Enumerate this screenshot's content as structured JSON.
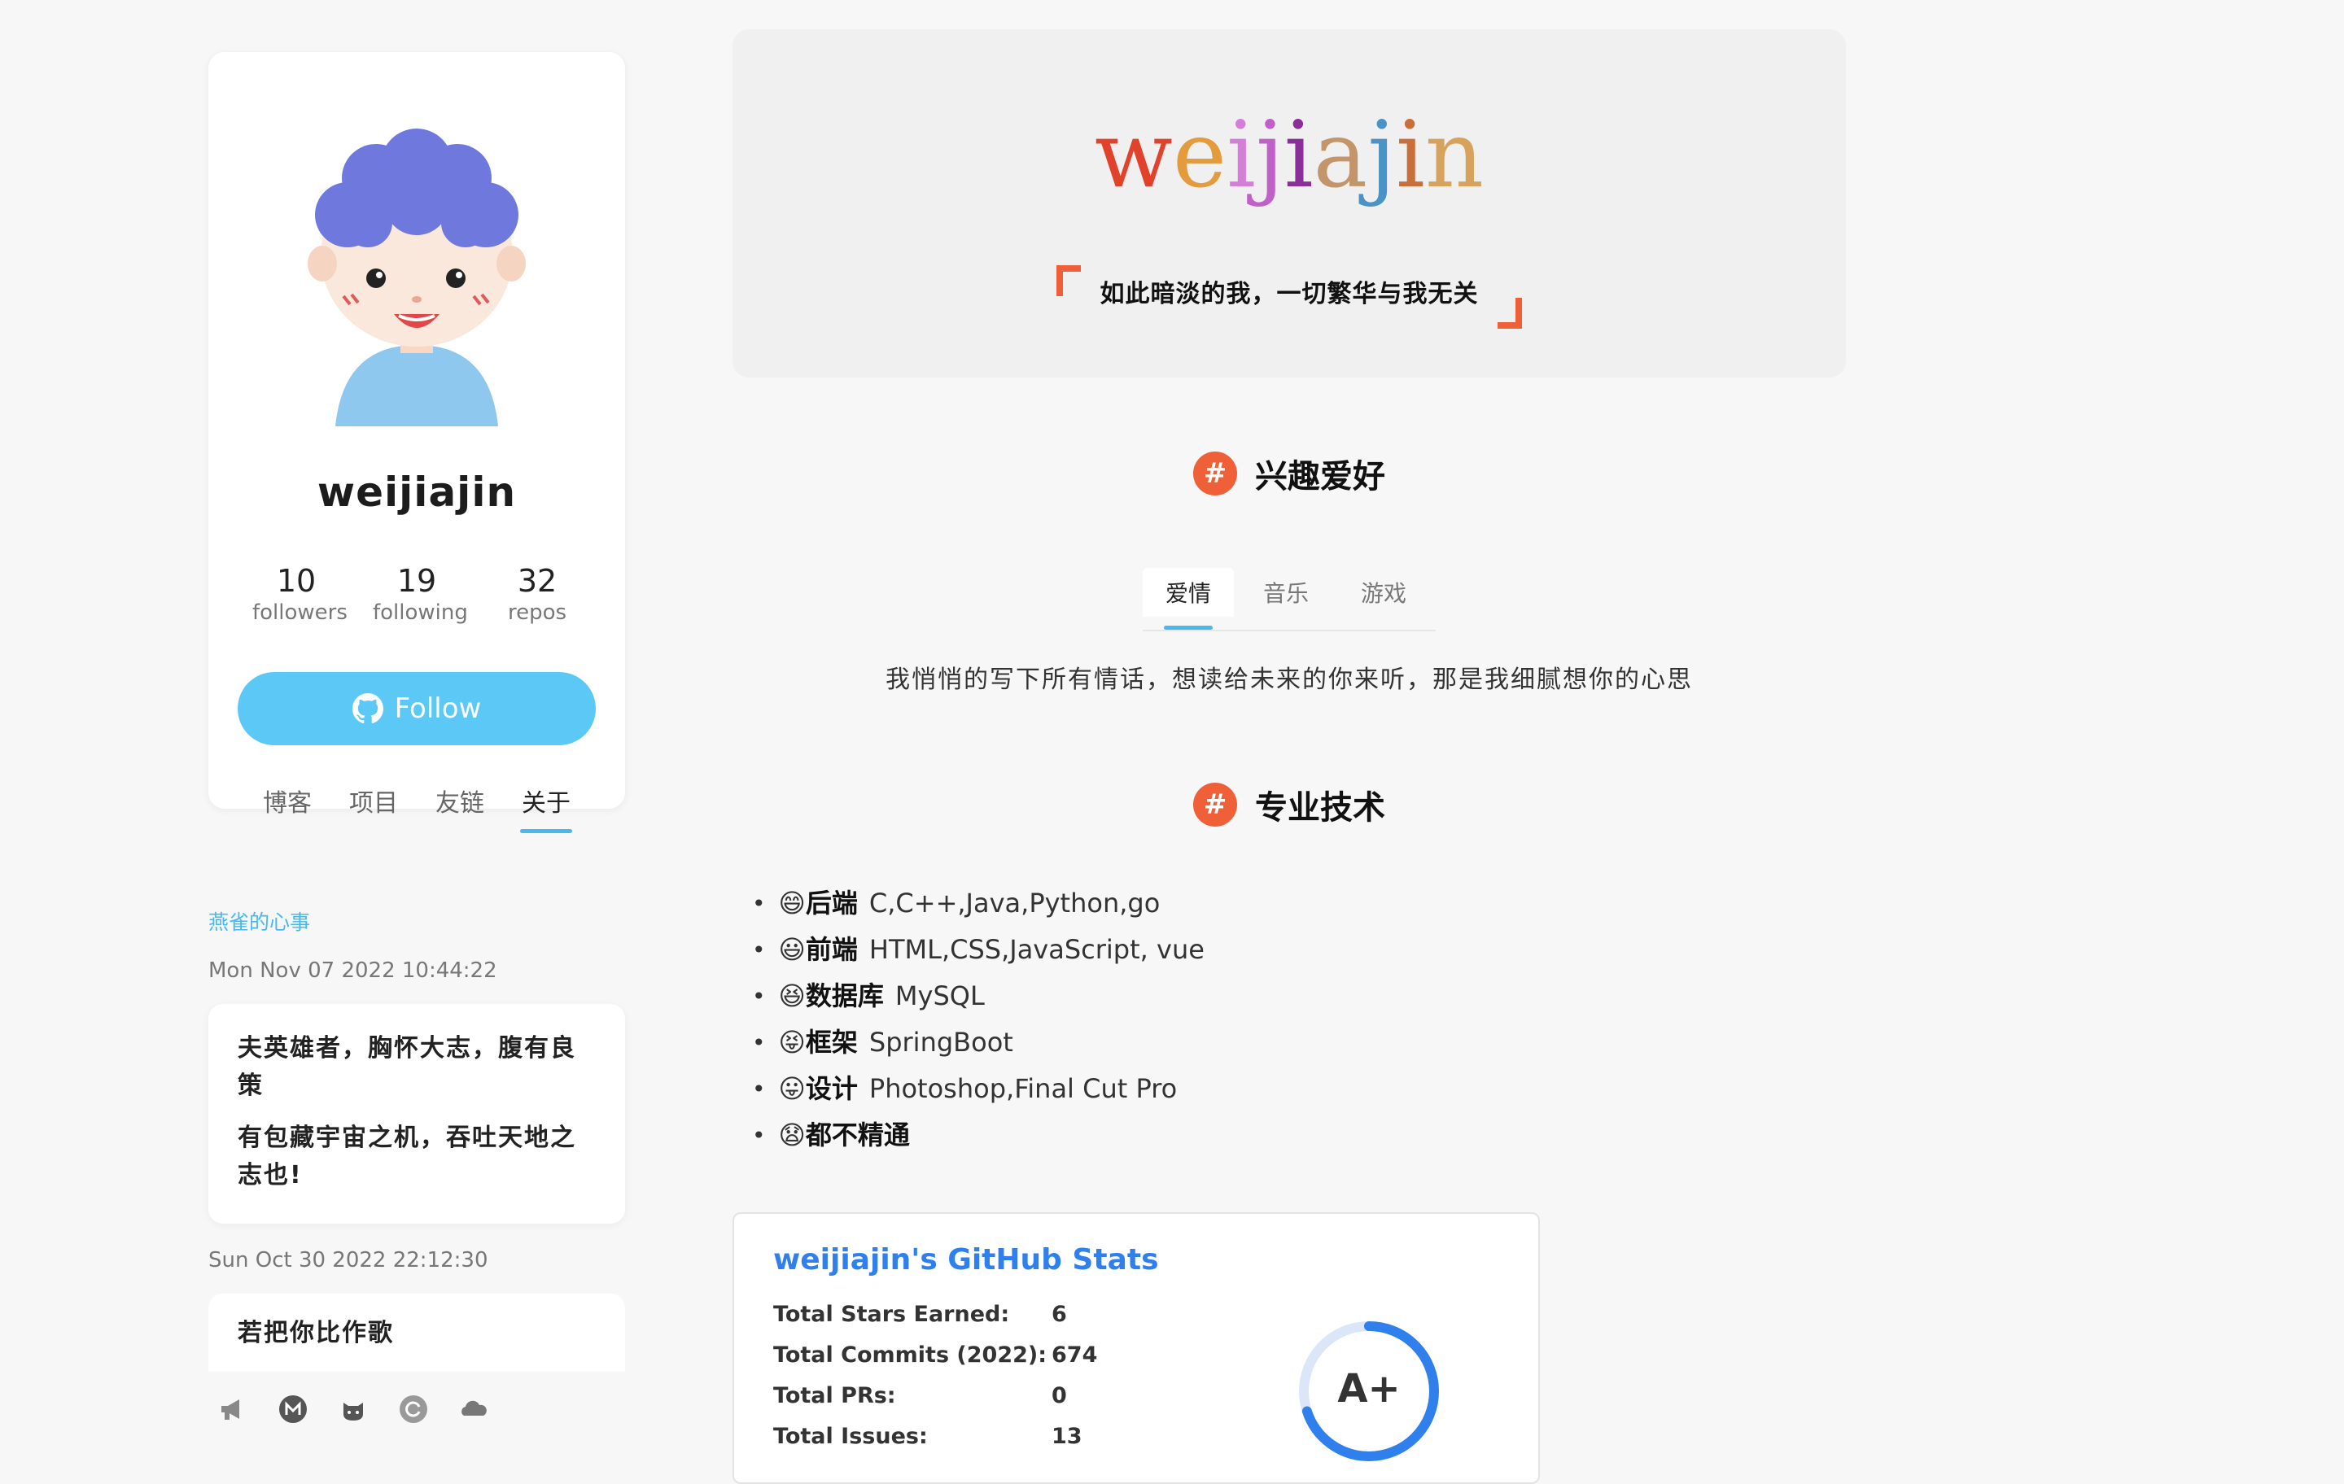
{
  "profile": {
    "username": "weijiajin",
    "stats": [
      {
        "value": "10",
        "label": "followers"
      },
      {
        "value": "19",
        "label": "following"
      },
      {
        "value": "32",
        "label": "repos"
      }
    ],
    "follow_label": "Follow",
    "nav": [
      {
        "label": "博客",
        "active": false
      },
      {
        "label": "项目",
        "active": false
      },
      {
        "label": "友链",
        "active": false
      },
      {
        "label": "关于",
        "active": true
      }
    ]
  },
  "sidebar_notes": {
    "title": "燕雀的心事",
    "items": [
      {
        "date": "Mon Nov 07 2022 10:44:22",
        "lines": [
          "夫英雄者，胸怀大志，腹有良策",
          "有包藏宇宙之机，吞吐天地之志也!"
        ]
      },
      {
        "date": "Sun Oct 30 2022 22:12:30",
        "lines": [
          "若把你比作歌"
        ]
      }
    ]
  },
  "footer_icons": [
    "megaphone-icon",
    "mail-icon",
    "github-icon",
    "refresh-icon",
    "cloud-icon"
  ],
  "banner": {
    "title_letters": [
      "w",
      "e",
      "i",
      "j",
      "i",
      "a",
      "j",
      "i",
      "n"
    ],
    "title_colors": [
      "#e0422c",
      "#e39b3b",
      "#d57ed8",
      "#c060c8",
      "#8a2f9a",
      "#c2956a",
      "#4b93c6",
      "#c96f3a",
      "#d6a25c"
    ],
    "quote": "如此暗淡的我，一切繁华与我无关"
  },
  "hobbies": {
    "heading": "兴趣爱好",
    "tabs": [
      {
        "label": "爱情",
        "active": true
      },
      {
        "label": "音乐",
        "active": false
      },
      {
        "label": "游戏",
        "active": false
      }
    ],
    "content": "我悄悄的写下所有情话，想读给未来的你来听，那是我细腻想你的心思"
  },
  "skills": {
    "heading": "专业技术",
    "items": [
      {
        "emoji": "😄",
        "key": "后端",
        "value": "C,C++,Java,Python,go"
      },
      {
        "emoji": "😃",
        "key": "前端",
        "value": "HTML,CSS,JavaScript, vue"
      },
      {
        "emoji": "😆",
        "key": "数据库",
        "value": "MySQL"
      },
      {
        "emoji": "😝",
        "key": "框架",
        "value": "SpringBoot"
      },
      {
        "emoji": "😛",
        "key": "设计",
        "value": "Photoshop,Final Cut Pro"
      },
      {
        "emoji": "😧",
        "key": "都不精通",
        "value": ""
      }
    ]
  },
  "github_stats": {
    "title": "weijiajin's GitHub Stats",
    "rows": [
      {
        "label": "Total Stars Earned:",
        "value": "6"
      },
      {
        "label": "Total Commits (2022):",
        "value": "674"
      },
      {
        "label": "Total PRs:",
        "value": "0"
      },
      {
        "label": "Total Issues:",
        "value": "13"
      }
    ],
    "rank": "A+",
    "rank_progress": 0.7,
    "accent": "#2f80ed"
  }
}
